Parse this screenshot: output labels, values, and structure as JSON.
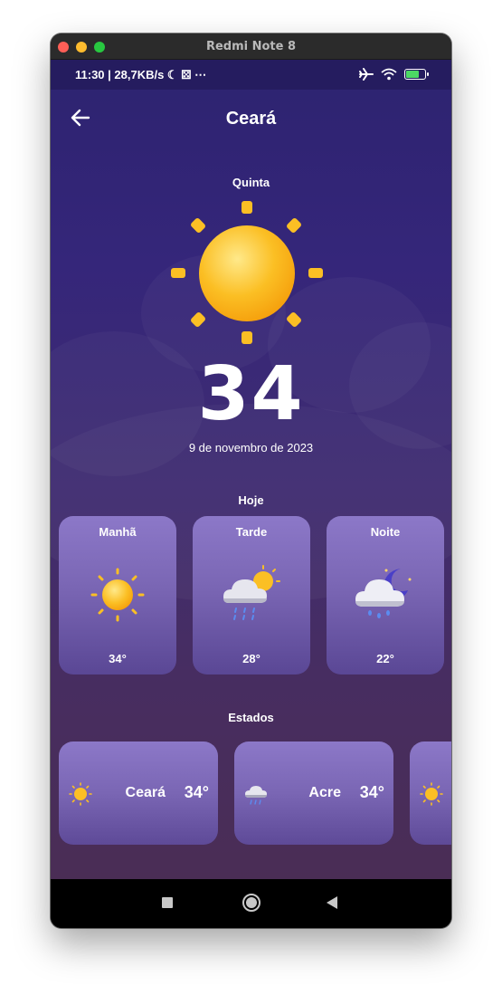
{
  "window": {
    "title": "Redmi Note 8"
  },
  "statusbar": {
    "left_text": "11:30 | 28,7KB/s ☾ ⚄ ⋯",
    "icons": [
      "airplane-icon",
      "wifi-icon",
      "battery-charging-icon"
    ]
  },
  "header": {
    "title": "Ceará",
    "back_icon": "arrow-left-icon"
  },
  "current": {
    "day": "Quinta",
    "icon": "sun-icon",
    "temperature": "34",
    "date": "9 de novembro de 2023"
  },
  "today": {
    "title": "Hoje",
    "periods": [
      {
        "name": "Manhã",
        "temp": "34°",
        "icon": "sun-icon"
      },
      {
        "name": "Tarde",
        "temp": "28°",
        "icon": "sun-cloud-rain-icon"
      },
      {
        "name": "Noite",
        "temp": "22°",
        "icon": "moon-cloud-rain-icon"
      }
    ]
  },
  "states": {
    "title": "Estados",
    "items": [
      {
        "name": "Ceará",
        "temp": "34°",
        "icon": "sun-icon"
      },
      {
        "name": "Acre",
        "temp": "34°",
        "icon": "storm-cloud-icon"
      },
      {
        "name": "",
        "temp": "",
        "icon": "sun-icon"
      }
    ]
  },
  "navbar": {
    "icons": [
      "recents-square-icon",
      "home-circle-icon",
      "back-triangle-icon"
    ]
  },
  "colors": {
    "accent_purple": "#8c78c8",
    "sun_yellow": "#fbbf24",
    "background_top": "#2d2370"
  }
}
